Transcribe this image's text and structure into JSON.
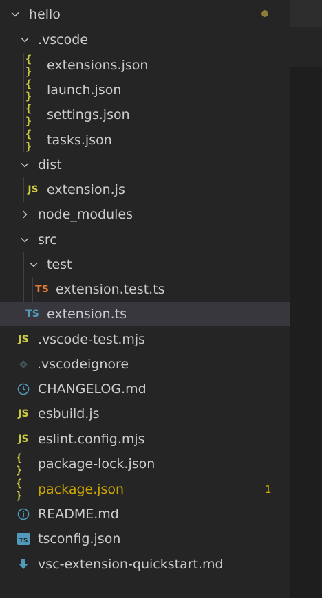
{
  "explorer": {
    "root": {
      "label": "hello",
      "dirty_color": "#8b7d3a"
    },
    "items": [
      {
        "label": ".vscode",
        "kind": "folder-open"
      },
      {
        "label": "extensions.json",
        "kind": "json",
        "icon_text": "{ }"
      },
      {
        "label": "launch.json",
        "kind": "json",
        "icon_text": "{ }"
      },
      {
        "label": "settings.json",
        "kind": "json",
        "icon_text": "{ }"
      },
      {
        "label": "tasks.json",
        "kind": "json",
        "icon_text": "{ }"
      },
      {
        "label": "dist",
        "kind": "folder-open"
      },
      {
        "label": "extension.js",
        "kind": "js",
        "icon_text": "JS"
      },
      {
        "label": "node_modules",
        "kind": "folder-closed"
      },
      {
        "label": "src",
        "kind": "folder-open"
      },
      {
        "label": "test",
        "kind": "folder-open"
      },
      {
        "label": "extension.test.ts",
        "kind": "ts-test",
        "icon_text": "TS"
      },
      {
        "label": "extension.ts",
        "kind": "ts",
        "icon_text": "TS",
        "selected": true
      },
      {
        "label": ".vscode-test.mjs",
        "kind": "js",
        "icon_text": "JS"
      },
      {
        "label": ".vscodeignore",
        "kind": "ignore"
      },
      {
        "label": "CHANGELOG.md",
        "kind": "changelog"
      },
      {
        "label": "esbuild.js",
        "kind": "js",
        "icon_text": "JS"
      },
      {
        "label": "eslint.config.mjs",
        "kind": "js",
        "icon_text": "JS"
      },
      {
        "label": "package-lock.json",
        "kind": "json",
        "icon_text": "{ }"
      },
      {
        "label": "package.json",
        "kind": "json",
        "icon_text": "{ }",
        "modified": true,
        "badge": "1"
      },
      {
        "label": "README.md",
        "kind": "info"
      },
      {
        "label": "tsconfig.json",
        "kind": "tsconfig",
        "icon_text": "TS"
      },
      {
        "label": "vsc-extension-quickstart.md",
        "kind": "download"
      }
    ]
  },
  "colors": {
    "json_icon": "#cbcb41",
    "js_icon": "#cbcb41",
    "ts_icon": "#519aba",
    "ts_test_icon": "#e37933",
    "modified_text": "#cca700",
    "selected_bg": "#37373d"
  }
}
